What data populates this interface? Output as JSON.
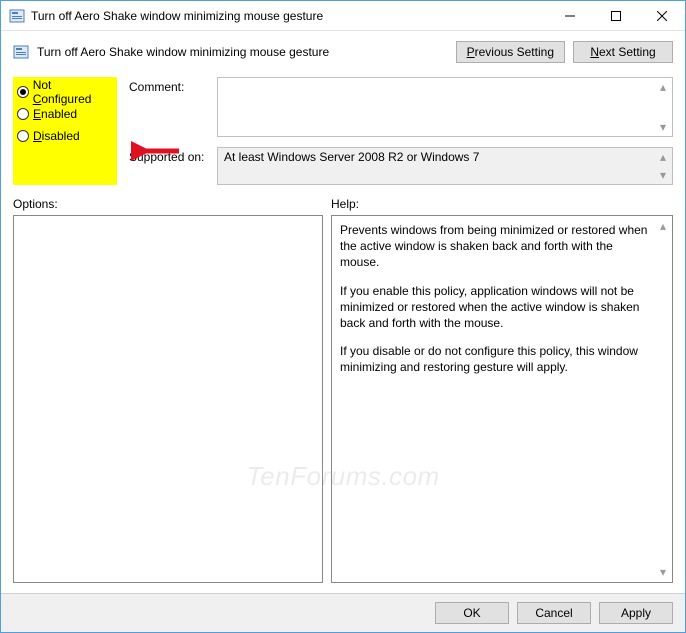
{
  "window": {
    "title": "Turn off Aero Shake window minimizing mouse gesture"
  },
  "header": {
    "title": "Turn off Aero Shake window minimizing mouse gesture",
    "prev": "Previous Setting",
    "next": "Next Setting"
  },
  "radios": {
    "not_configured": "Not Configured",
    "enabled": "Enabled",
    "disabled": "Disabled",
    "selected": "not_configured"
  },
  "labels": {
    "comment": "Comment:",
    "supported": "Supported on:",
    "options": "Options:",
    "help": "Help:"
  },
  "comment": "",
  "supported_on": "At least Windows Server 2008 R2 or Windows 7",
  "help": {
    "p1": "Prevents windows from being minimized or restored when the active window is shaken back and forth with the mouse.",
    "p2": "If you enable this policy, application windows will not be minimized or restored when the active window is shaken back and forth with the mouse.",
    "p3": "If you disable or do not configure this policy, this window minimizing and restoring gesture will apply."
  },
  "footer": {
    "ok": "OK",
    "cancel": "Cancel",
    "apply": "Apply"
  },
  "watermark": "TenForums.com"
}
